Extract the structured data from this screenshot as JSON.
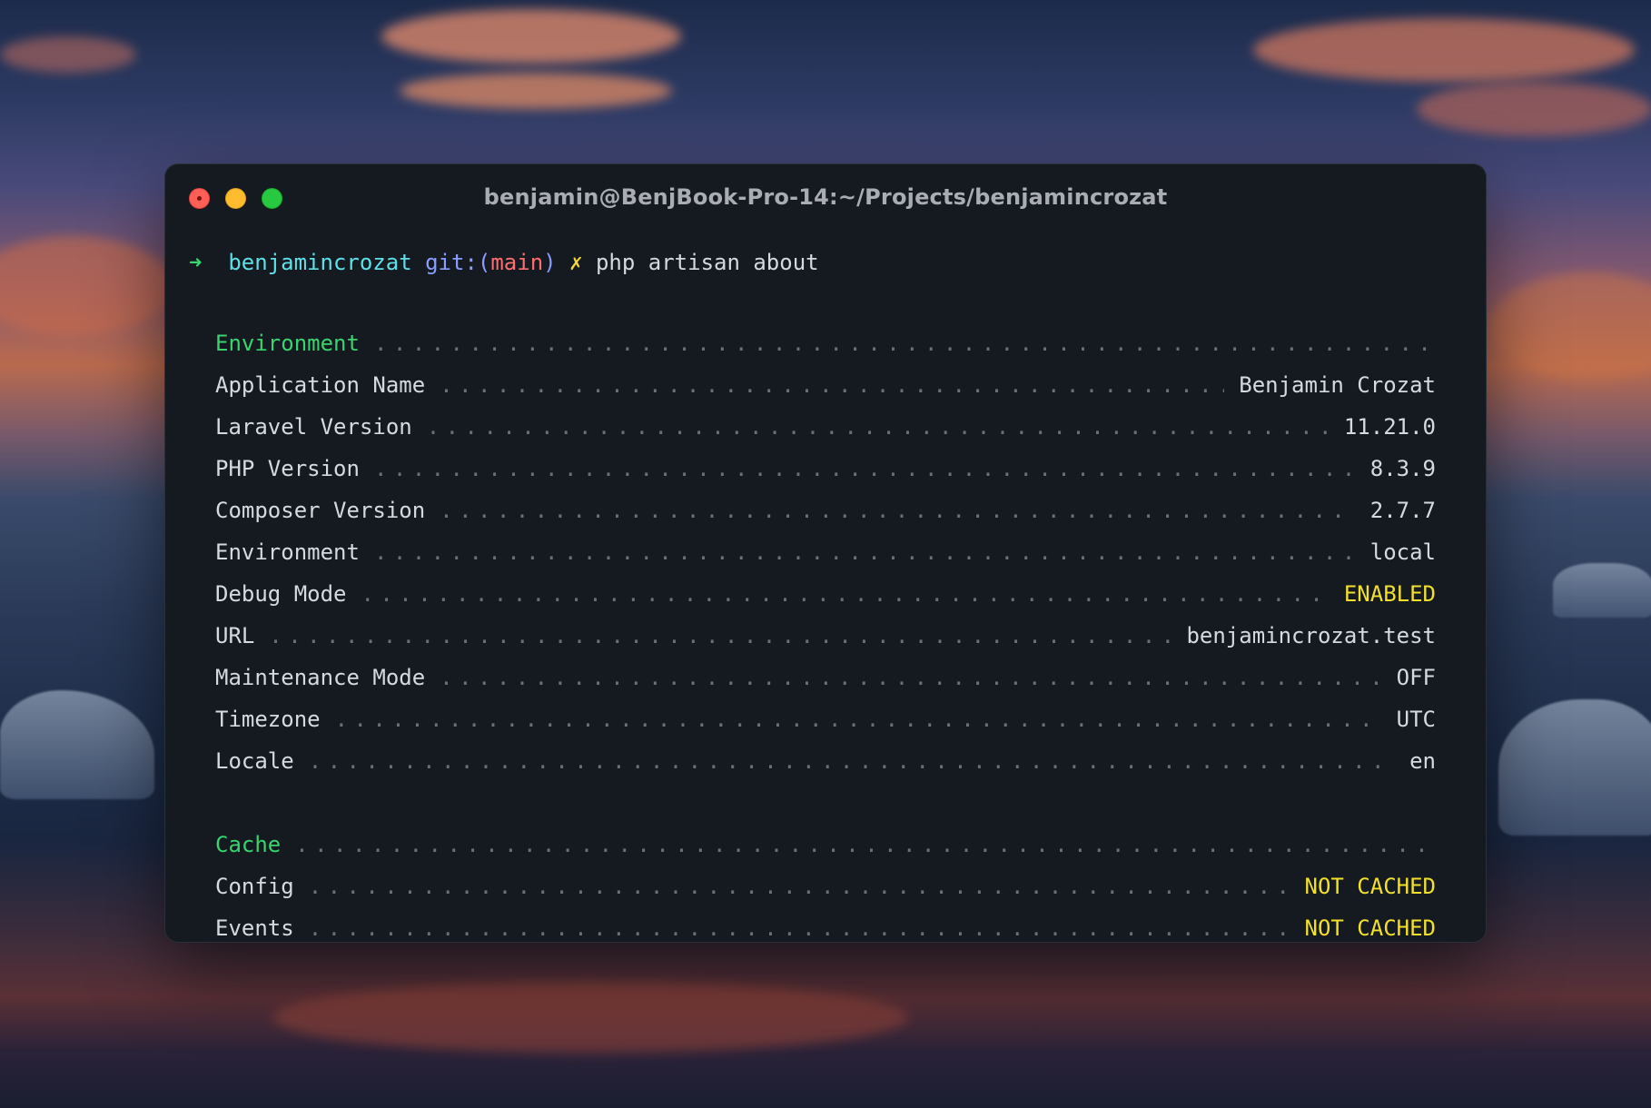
{
  "window": {
    "title": "benjamin@BenjBook-Pro-14:~/Projects/benjamincrozat"
  },
  "prompt": {
    "arrow": "➜",
    "directory": "benjamincrozat",
    "git_prefix": "git:(",
    "branch": "main",
    "git_suffix": ")",
    "dirty_mark": "✗",
    "command": "php artisan about"
  },
  "sections": [
    {
      "title": "Environment",
      "rows": [
        {
          "label": "Application Name",
          "value": "Benjamin Crozat"
        },
        {
          "label": "Laravel Version",
          "value": "11.21.0"
        },
        {
          "label": "PHP Version",
          "value": "8.3.9"
        },
        {
          "label": "Composer Version",
          "value": "2.7.7"
        },
        {
          "label": "Environment",
          "value": "local"
        },
        {
          "label": "Debug Mode",
          "value": "ENABLED"
        },
        {
          "label": "URL",
          "value": "benjamincrozat.test"
        },
        {
          "label": "Maintenance Mode",
          "value": "OFF"
        },
        {
          "label": "Timezone",
          "value": "UTC"
        },
        {
          "label": "Locale",
          "value": "en"
        }
      ]
    },
    {
      "title": "Cache",
      "rows": [
        {
          "label": "Config",
          "value": "NOT CACHED"
        },
        {
          "label": "Events",
          "value": "NOT CACHED"
        }
      ]
    }
  ],
  "colors": {
    "section_heading": "#3ad46e",
    "warning_value": "#f2e02a",
    "terminal_bg": "#151a21"
  }
}
